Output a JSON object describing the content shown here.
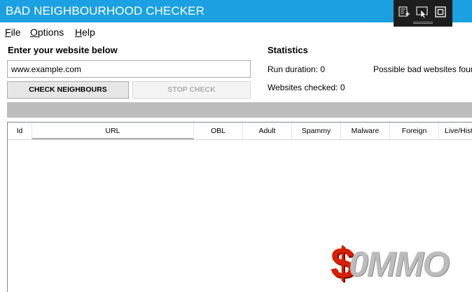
{
  "window": {
    "title": "BAD NEIGHBOURHOOD CHECKER"
  },
  "menu": [
    {
      "accel": "F",
      "rest": "ile"
    },
    {
      "accel": "O",
      "rest": "ptions"
    },
    {
      "accel": "H",
      "rest": "elp"
    }
  ],
  "input": {
    "label": "Enter your website below",
    "value": "www.example.com"
  },
  "buttons": {
    "check": "CHECK NEIGHBOURS",
    "stop": "STOP CHECK"
  },
  "statistics": {
    "title": "Statistics",
    "run_duration": "Run duration: 0",
    "websites_checked": "Websites checked: 0",
    "possible_bad": "Possible bad websites foun"
  },
  "progress": {
    "value": 0
  },
  "table": {
    "columns": [
      "Id",
      "URL",
      "OBL",
      "Adult",
      "Spammy",
      "Malware",
      "Foreign",
      "Live/Histo"
    ],
    "rows": []
  },
  "watermark": {
    "text": "0MMO",
    "symbol": "$"
  },
  "colors": {
    "titlebar": "#1ba1e2",
    "progress_track": "#bcbcbc"
  }
}
